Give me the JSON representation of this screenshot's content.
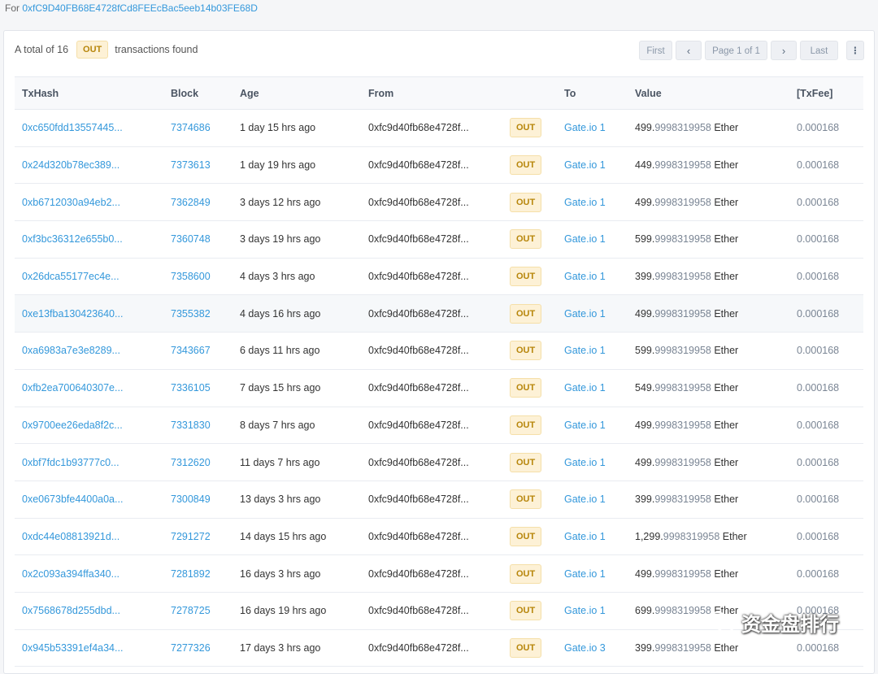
{
  "header": {
    "for_prefix": "For",
    "address": "0xfC9D40FB68E4728fCd8FEEcBac5eeb14b03FE68D"
  },
  "summary": {
    "prefix": "A total of 16",
    "badge": "OUT",
    "suffix": "transactions found"
  },
  "pager": {
    "first": "First",
    "prev": "‹",
    "page_info": "Page 1 of 1",
    "next": "›",
    "last": "Last",
    "menu": "⋮"
  },
  "table": {
    "columns": {
      "txhash": "TxHash",
      "block": "Block",
      "age": "Age",
      "from": "From",
      "dir": "",
      "to": "To",
      "value": "Value",
      "txfee": "[TxFee]"
    },
    "rows": [
      {
        "txhash": "0xc650fdd13557445...",
        "block": "7374686",
        "age": "1 day 15 hrs ago",
        "from": "0xfc9d40fb68e4728f...",
        "dir": "OUT",
        "to": "Gate.io 1",
        "value_int": "499.",
        "value_dec": "9998319958",
        "value_unit": " Ether",
        "txfee": "0.000168"
      },
      {
        "txhash": "0x24d320b78ec389...",
        "block": "7373613",
        "age": "1 day 19 hrs ago",
        "from": "0xfc9d40fb68e4728f...",
        "dir": "OUT",
        "to": "Gate.io 1",
        "value_int": "449.",
        "value_dec": "9998319958",
        "value_unit": " Ether",
        "txfee": "0.000168"
      },
      {
        "txhash": "0xb6712030a94eb2...",
        "block": "7362849",
        "age": "3 days 12 hrs ago",
        "from": "0xfc9d40fb68e4728f...",
        "dir": "OUT",
        "to": "Gate.io 1",
        "value_int": "499.",
        "value_dec": "9998319958",
        "value_unit": " Ether",
        "txfee": "0.000168"
      },
      {
        "txhash": "0xf3bc36312e655b0...",
        "block": "7360748",
        "age": "3 days 19 hrs ago",
        "from": "0xfc9d40fb68e4728f...",
        "dir": "OUT",
        "to": "Gate.io 1",
        "value_int": "599.",
        "value_dec": "9998319958",
        "value_unit": " Ether",
        "txfee": "0.000168"
      },
      {
        "txhash": "0x26dca55177ec4e...",
        "block": "7358600",
        "age": "4 days 3 hrs ago",
        "from": "0xfc9d40fb68e4728f...",
        "dir": "OUT",
        "to": "Gate.io 1",
        "value_int": "399.",
        "value_dec": "9998319958",
        "value_unit": " Ether",
        "txfee": "0.000168"
      },
      {
        "txhash": "0xe13fba130423640...",
        "block": "7355382",
        "age": "4 days 16 hrs ago",
        "from": "0xfc9d40fb68e4728f...",
        "dir": "OUT",
        "to": "Gate.io 1",
        "value_int": "499.",
        "value_dec": "9998319958",
        "value_unit": " Ether",
        "txfee": "0.000168"
      },
      {
        "txhash": "0xa6983a7e3e8289...",
        "block": "7343667",
        "age": "6 days 11 hrs ago",
        "from": "0xfc9d40fb68e4728f...",
        "dir": "OUT",
        "to": "Gate.io 1",
        "value_int": "599.",
        "value_dec": "9998319958",
        "value_unit": " Ether",
        "txfee": "0.000168"
      },
      {
        "txhash": "0xfb2ea700640307e...",
        "block": "7336105",
        "age": "7 days 15 hrs ago",
        "from": "0xfc9d40fb68e4728f...",
        "dir": "OUT",
        "to": "Gate.io 1",
        "value_int": "549.",
        "value_dec": "9998319958",
        "value_unit": " Ether",
        "txfee": "0.000168"
      },
      {
        "txhash": "0x9700ee26eda8f2c...",
        "block": "7331830",
        "age": "8 days 7 hrs ago",
        "from": "0xfc9d40fb68e4728f...",
        "dir": "OUT",
        "to": "Gate.io 1",
        "value_int": "499.",
        "value_dec": "9998319958",
        "value_unit": " Ether",
        "txfee": "0.000168"
      },
      {
        "txhash": "0xbf7fdc1b93777c0...",
        "block": "7312620",
        "age": "11 days 7 hrs ago",
        "from": "0xfc9d40fb68e4728f...",
        "dir": "OUT",
        "to": "Gate.io 1",
        "value_int": "499.",
        "value_dec": "9998319958",
        "value_unit": " Ether",
        "txfee": "0.000168"
      },
      {
        "txhash": "0xe0673bfe4400a0a...",
        "block": "7300849",
        "age": "13 days 3 hrs ago",
        "from": "0xfc9d40fb68e4728f...",
        "dir": "OUT",
        "to": "Gate.io 1",
        "value_int": "399.",
        "value_dec": "9998319958",
        "value_unit": " Ether",
        "txfee": "0.000168"
      },
      {
        "txhash": "0xdc44e08813921d...",
        "block": "7291272",
        "age": "14 days 15 hrs ago",
        "from": "0xfc9d40fb68e4728f...",
        "dir": "OUT",
        "to": "Gate.io 1",
        "value_int": "1,299.",
        "value_dec": "9998319958",
        "value_unit": " Ether",
        "txfee": "0.000168"
      },
      {
        "txhash": "0x2c093a394ffa340...",
        "block": "7281892",
        "age": "16 days 3 hrs ago",
        "from": "0xfc9d40fb68e4728f...",
        "dir": "OUT",
        "to": "Gate.io 1",
        "value_int": "499.",
        "value_dec": "9998319958",
        "value_unit": " Ether",
        "txfee": "0.000168"
      },
      {
        "txhash": "0x7568678d255dbd...",
        "block": "7278725",
        "age": "16 days 19 hrs ago",
        "from": "0xfc9d40fb68e4728f...",
        "dir": "OUT",
        "to": "Gate.io 1",
        "value_int": "699.",
        "value_dec": "9998319958",
        "value_unit": " Ether",
        "txfee": "0.000168"
      },
      {
        "txhash": "0x945b53391ef4a34...",
        "block": "7277326",
        "age": "17 days 3 hrs ago",
        "from": "0xfc9d40fb68e4728f...",
        "dir": "OUT",
        "to": "Gate.io 3",
        "value_int": "399.",
        "value_dec": "9998319958",
        "value_unit": " Ether",
        "txfee": "0.000168"
      }
    ]
  },
  "watermark": {
    "text": "资金盘排行",
    "icon": "wechat-logo-icon"
  }
}
